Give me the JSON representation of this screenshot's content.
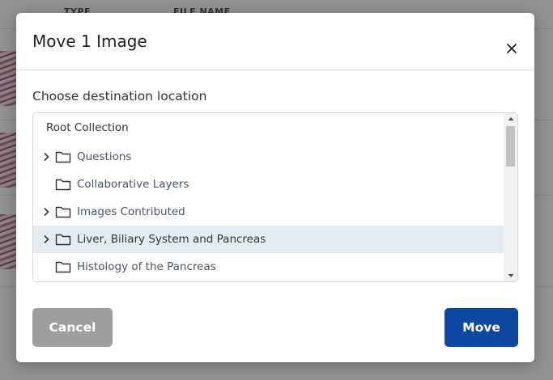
{
  "background": {
    "columns": {
      "type": "TYPE",
      "file_name": "FILE NAME"
    }
  },
  "modal": {
    "title": "Move 1 Image",
    "section_label": "Choose destination location",
    "tree": {
      "root": "Root Collection",
      "items": [
        {
          "label": "Questions",
          "expandable": true,
          "selected": false
        },
        {
          "label": "Collaborative Layers",
          "expandable": false,
          "selected": false
        },
        {
          "label": "Images Contributed",
          "expandable": true,
          "selected": false
        },
        {
          "label": "Liver, Biliary System and Pancreas",
          "expandable": true,
          "selected": true
        },
        {
          "label": "Histology of the Pancreas",
          "expandable": false,
          "selected": false
        }
      ]
    },
    "buttons": {
      "cancel": "Cancel",
      "move": "Move"
    }
  },
  "colors": {
    "primary": "#0c47a1",
    "secondary": "#9e9e9e",
    "selected_row": "#e5ebf3"
  },
  "icons": [
    "close-icon",
    "chevron-right-icon",
    "folder-icon",
    "scroll-up-icon",
    "scroll-down-icon"
  ]
}
